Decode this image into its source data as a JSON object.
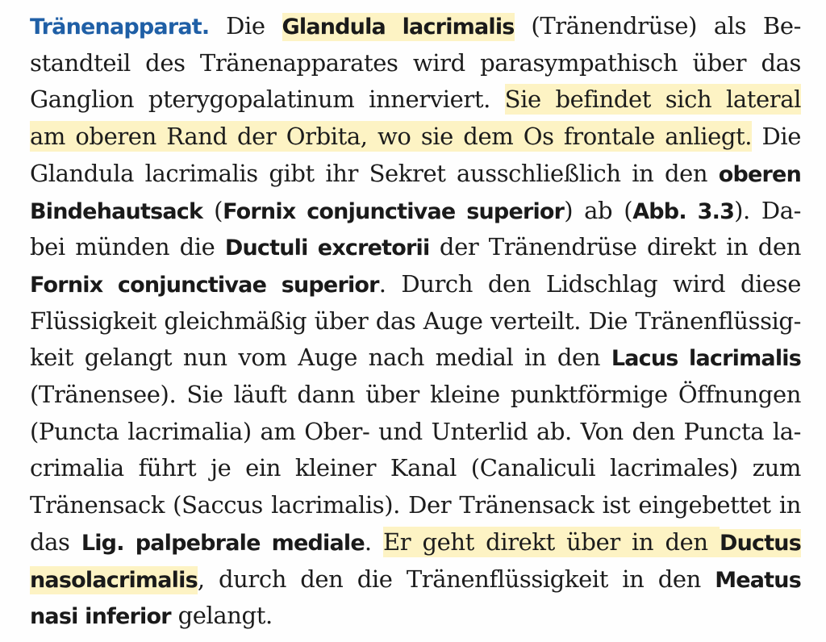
{
  "paragraph": {
    "heading": "Tränenapparat.",
    "lines": [
      [
        {
          "t": "Tränenapparat.",
          "s": "head"
        },
        {
          "t": " Die "
        },
        {
          "t": "Glandula lacrimalis",
          "s": "b",
          "h": true
        },
        {
          "t": " (Tränendrüse) als Be-"
        }
      ],
      [
        {
          "t": "standteil des Tränenapparates wird parasympathisch über das"
        }
      ],
      [
        {
          "t": "Ganglion pterygopalatinum innerviert. "
        },
        {
          "t": "Sie befindet sich lateral",
          "h": true
        }
      ],
      [
        {
          "t": "am oberen Rand der Orbita, wo sie dem Os frontale anliegt.",
          "h": true
        },
        {
          "t": " Die"
        }
      ],
      [
        {
          "t": "Glandula lacrimalis gibt ihr Sekret ausschließlich in den "
        },
        {
          "t": "oberen",
          "s": "b"
        }
      ],
      [
        {
          "t": "Bindehautsack",
          "s": "b"
        },
        {
          "t": " ("
        },
        {
          "t": "Fornix conjunctivae superior",
          "s": "b"
        },
        {
          "t": ") ab ("
        },
        {
          "t": "Abb. 3.3",
          "s": "b"
        },
        {
          "t": "). Da-"
        }
      ],
      [
        {
          "t": "bei münden die "
        },
        {
          "t": "Ductuli excretorii",
          "s": "b"
        },
        {
          "t": " der Tränendrüse direkt in den"
        }
      ],
      [
        {
          "t": "Fornix conjunctivae superior",
          "s": "b"
        },
        {
          "t": ". Durch den Lidschlag wird diese"
        }
      ],
      [
        {
          "t": "Flüssigkeit gleichmäßig über das Auge verteilt. Die Tränenflüssig-"
        }
      ],
      [
        {
          "t": "keit gelangt nun vom Auge nach medial in den "
        },
        {
          "t": "Lacus lacrimalis",
          "s": "b"
        }
      ],
      [
        {
          "t": "(Tränensee). Sie läuft dann über kleine punktförmige Öffnungen"
        }
      ],
      [
        {
          "t": "(Puncta lacrimalia) am Ober- und Unterlid ab. Von den Puncta la-"
        }
      ],
      [
        {
          "t": "crimalia führt je ein kleiner Kanal (Canaliculi lacrimales) zum"
        }
      ],
      [
        {
          "t": "Tränensack (Saccus lacrimalis). Der Tränensack ist eingebettet in"
        }
      ],
      [
        {
          "t": "das "
        },
        {
          "t": "Lig. palpebrale mediale",
          "s": "b"
        },
        {
          "t": ". "
        },
        {
          "t": "Er geht direkt über in den ",
          "h": true
        },
        {
          "t": "Ductus",
          "s": "b",
          "h": true
        }
      ],
      [
        {
          "t": "nasolacrimalis",
          "s": "b",
          "h": true
        },
        {
          "t": ", durch den die Tränenflüssigkeit in den "
        },
        {
          "t": "Meatus",
          "s": "b"
        }
      ],
      [
        {
          "t": "nasi inferior",
          "s": "b"
        },
        {
          "t": " gelangt."
        }
      ]
    ]
  },
  "colors": {
    "heading": "#1f5fa6",
    "highlight": "#fdf3c4",
    "text": "#1c1c1c"
  }
}
